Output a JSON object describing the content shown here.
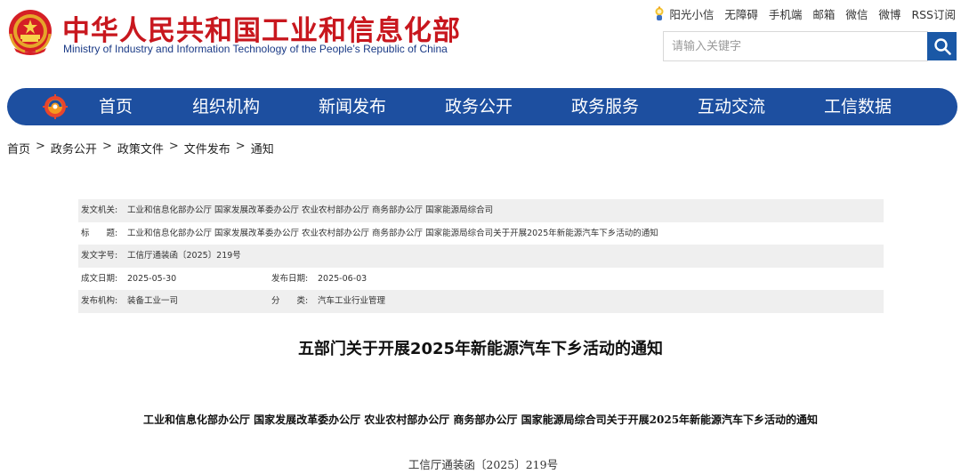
{
  "header": {
    "title": "中华人民共和国工业和信息化部",
    "subtitle": "Ministry of Industry and Information Technology of the People’s Republic of China",
    "top_links": [
      "阳光小信",
      "无障碍",
      "手机端",
      "邮箱",
      "微信",
      "微博",
      "RSS订阅"
    ],
    "search_placeholder": "请输入关键字"
  },
  "nav": {
    "items": [
      "首页",
      "组织机构",
      "新闻发布",
      "政务公开",
      "政务服务",
      "互动交流",
      "工信数据"
    ]
  },
  "breadcrumb": [
    "首页",
    "政务公开",
    "政策文件",
    "文件发布",
    "通知"
  ],
  "breadcrumb_separator": ">",
  "meta": {
    "issuer_label": "发文机关:",
    "issuer": "工业和信息化部办公厅 国家发展改革委办公厅 农业农村部办公厅 商务部办公厅 国家能源局综合司",
    "title_label": "标　　题:",
    "title": "工业和信息化部办公厅 国家发展改革委办公厅 农业农村部办公厅 商务部办公厅 国家能源局综合司关于开展2025年新能源汽车下乡活动的通知",
    "doc_no_label": "发文字号:",
    "doc_no": "工信厅通装函〔2025〕219号",
    "created_label": "成文日期:",
    "created": "2025-05-30",
    "published_label": "发布日期:",
    "published": "2025-06-03",
    "org_label": "发布机构:",
    "org": "装备工业一司",
    "category_label": "分　　类:",
    "category": "汽车工业行业管理"
  },
  "document": {
    "title": "五部门关于开展2025年新能源汽车下乡活动的通知",
    "subtitle": "工业和信息化部办公厅 国家发展改革委办公厅 农业农村部办公厅 商务部办公厅 国家能源局综合司关于开展2025年新能源汽车下乡活动的通知",
    "number": "工信厅通装函〔2025〕219号"
  },
  "colors": {
    "brand_red": "#c8171e",
    "brand_blue": "#1d4fa0",
    "search_button": "#1a58a6"
  },
  "icons": {
    "emblem": "national-emblem-icon",
    "sun": "sun-mascot-icon",
    "search": "search-icon",
    "nav_logo": "miit-logo-icon"
  }
}
